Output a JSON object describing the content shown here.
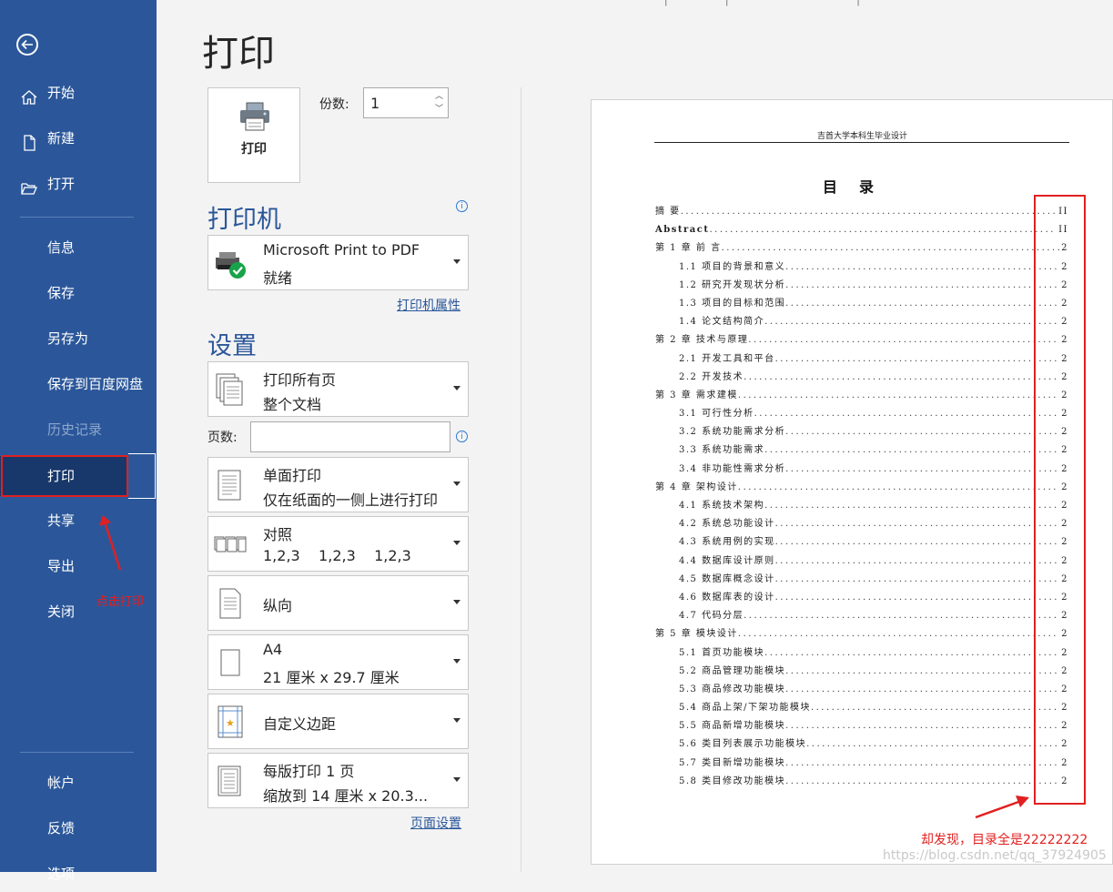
{
  "sidebar": {
    "items": [
      {
        "label": "开始",
        "icon": "home-icon"
      },
      {
        "label": "新建",
        "icon": "new-document-icon"
      },
      {
        "label": "打开",
        "icon": "folder-open-icon"
      },
      {
        "label": "信息"
      },
      {
        "label": "保存"
      },
      {
        "label": "另存为"
      },
      {
        "label": "保存到百度网盘"
      },
      {
        "label": "历史记录",
        "disabled": true
      },
      {
        "label": "打印",
        "active": true
      },
      {
        "label": "共享"
      },
      {
        "label": "导出"
      },
      {
        "label": "关闭"
      },
      {
        "label": "帐户"
      },
      {
        "label": "反馈"
      },
      {
        "label": "选项"
      }
    ],
    "annotation": "点击打印"
  },
  "main": {
    "title": "打印",
    "print_button_label": "打印",
    "copies_label": "份数:",
    "copies_value": "1",
    "printer_heading": "打印机",
    "printer": {
      "name": "Microsoft Print to PDF",
      "status": "就绪"
    },
    "printer_properties_link": "打印机属性",
    "settings_heading": "设置",
    "settings": [
      {
        "l1": "打印所有页",
        "l2": "整个文档"
      },
      {
        "l1": "单面打印",
        "l2": "仅在纸面的一侧上进行打印"
      },
      {
        "l1": "对照",
        "l2": "1,2,3    1,2,3    1,2,3"
      },
      {
        "l1": "纵向"
      },
      {
        "l1": "A4",
        "l2": "21 厘米 x 29.7 厘米"
      },
      {
        "l1": "自定义边距"
      },
      {
        "l1": "每版打印 1 页",
        "l2": "缩放到 14 厘米 x 20.3..."
      }
    ],
    "pages_label": "页数:",
    "pages_value": "",
    "page_setup_link": "页面设置"
  },
  "preview": {
    "header": "吉首大学本科生毕业设计",
    "title": "目录",
    "toc": [
      {
        "text": "摘   要",
        "page": "II",
        "level": 1
      },
      {
        "text": "Abstract",
        "page": "II",
        "level": 1,
        "bold": true
      },
      {
        "text": "第 1 章  前  言",
        "page": "2",
        "level": 1
      },
      {
        "text": "1.1  项目的背景和意义",
        "page": "2",
        "level": 2
      },
      {
        "text": "1.2  研究开发现状分析",
        "page": "2",
        "level": 2
      },
      {
        "text": "1.3  项目的目标和范围",
        "page": "2",
        "level": 2
      },
      {
        "text": "1.4  论文结构简介",
        "page": "2",
        "level": 2
      },
      {
        "text": "第 2 章  技术与原理",
        "page": "2",
        "level": 1
      },
      {
        "text": "2.1  开发工具和平台",
        "page": "2",
        "level": 2
      },
      {
        "text": "2.2  开发技术",
        "page": "2",
        "level": 2
      },
      {
        "text": "第 3 章  需求建模",
        "page": "2",
        "level": 1
      },
      {
        "text": "3.1  可行性分析",
        "page": "2",
        "level": 2
      },
      {
        "text": "3.2  系统功能需求分析",
        "page": "2",
        "level": 2
      },
      {
        "text": "3.3  系统功能需求",
        "page": "2",
        "level": 2
      },
      {
        "text": "3.4  非功能性需求分析",
        "page": "2",
        "level": 2
      },
      {
        "text": "第 4 章  架构设计",
        "page": "2",
        "level": 1
      },
      {
        "text": "4.1  系统技术架构",
        "page": "2",
        "level": 2
      },
      {
        "text": "4.2  系统总功能设计",
        "page": "2",
        "level": 2
      },
      {
        "text": "4.3  系统用例的实现",
        "page": "2",
        "level": 2
      },
      {
        "text": "4.4  数据库设计原则",
        "page": "2",
        "level": 2
      },
      {
        "text": "4.5  数据库概念设计",
        "page": "2",
        "level": 2
      },
      {
        "text": "4.6  数据库表的设计",
        "page": "2",
        "level": 2
      },
      {
        "text": "4.7  代码分层",
        "page": "2",
        "level": 2
      },
      {
        "text": "第 5 章  模块设计",
        "page": "2",
        "level": 1
      },
      {
        "text": "5.1  首页功能模块",
        "page": "2",
        "level": 2
      },
      {
        "text": "5.2  商品管理功能模块",
        "page": "2",
        "level": 2
      },
      {
        "text": "5.3  商品修改功能模块",
        "page": "2",
        "level": 2
      },
      {
        "text": "5.4  商品上架/下架功能模块",
        "page": "2",
        "level": 2
      },
      {
        "text": "5.5  商品新增功能模块",
        "page": "2",
        "level": 2
      },
      {
        "text": "5.6  类目列表展示功能模块",
        "page": "2",
        "level": 2
      },
      {
        "text": "5.7  类目新增功能模块",
        "page": "2",
        "level": 2
      },
      {
        "text": "5.8  类目修改功能模块",
        "page": "2",
        "level": 2
      }
    ],
    "annotation": "却发现，目录全是22222222",
    "watermark": "https://blog.csdn.net/qq_37924905"
  },
  "colors": {
    "sidebar": "#2b579a",
    "active": "#18386b",
    "annotation": "#e02020"
  }
}
